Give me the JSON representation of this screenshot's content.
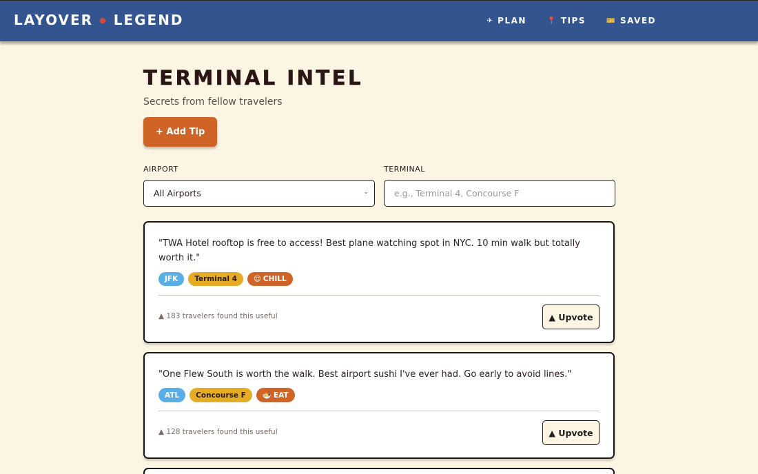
{
  "brand": {
    "name_left": "LAYOVER",
    "name_right": "LEGEND",
    "separator_icon": "dot-icon"
  },
  "nav": [
    {
      "icon": "plane-icon",
      "glyph": "✈",
      "label": "PLAN"
    },
    {
      "icon": "pin-icon",
      "glyph": "📍",
      "label": "TIPS"
    },
    {
      "icon": "ticket-icon",
      "glyph": "🎫",
      "label": "SAVED"
    }
  ],
  "page": {
    "title": "TERMINAL INTEL",
    "subtitle": "Secrets from fellow travelers",
    "add_button": "+ Add Tip"
  },
  "filters": {
    "airport_label": "AIRPORT",
    "airport_value": "All Airports",
    "terminal_label": "TERMINAL",
    "terminal_placeholder": "e.g., Terminal 4, Concourse F"
  },
  "tips": [
    {
      "text": "\"TWA Hotel rooftop is free to access! Best plane watching spot in NYC. 10 min walk but totally worth it.\"",
      "airport": "JFK",
      "terminal": "Terminal 4",
      "category_emoji": "😌",
      "category": "CHILL",
      "useful": "▲ 183 travelers found this useful",
      "upvote": "▲ Upvote"
    },
    {
      "text": "\"One Flew South is worth the walk. Best airport sushi I've ever had. Go early to avoid lines.\"",
      "airport": "ATL",
      "terminal": "Concourse F",
      "category_emoji": "🍜",
      "category": "EAT",
      "useful": "▲ 128 travelers found this useful",
      "upvote": "▲ Upvote"
    }
  ],
  "colors": {
    "header": "#33548f",
    "background": "#fdf5e4",
    "accent": "#cf6426",
    "airport_tag": "#5aaee6",
    "terminal_tag": "#e6ac24"
  }
}
